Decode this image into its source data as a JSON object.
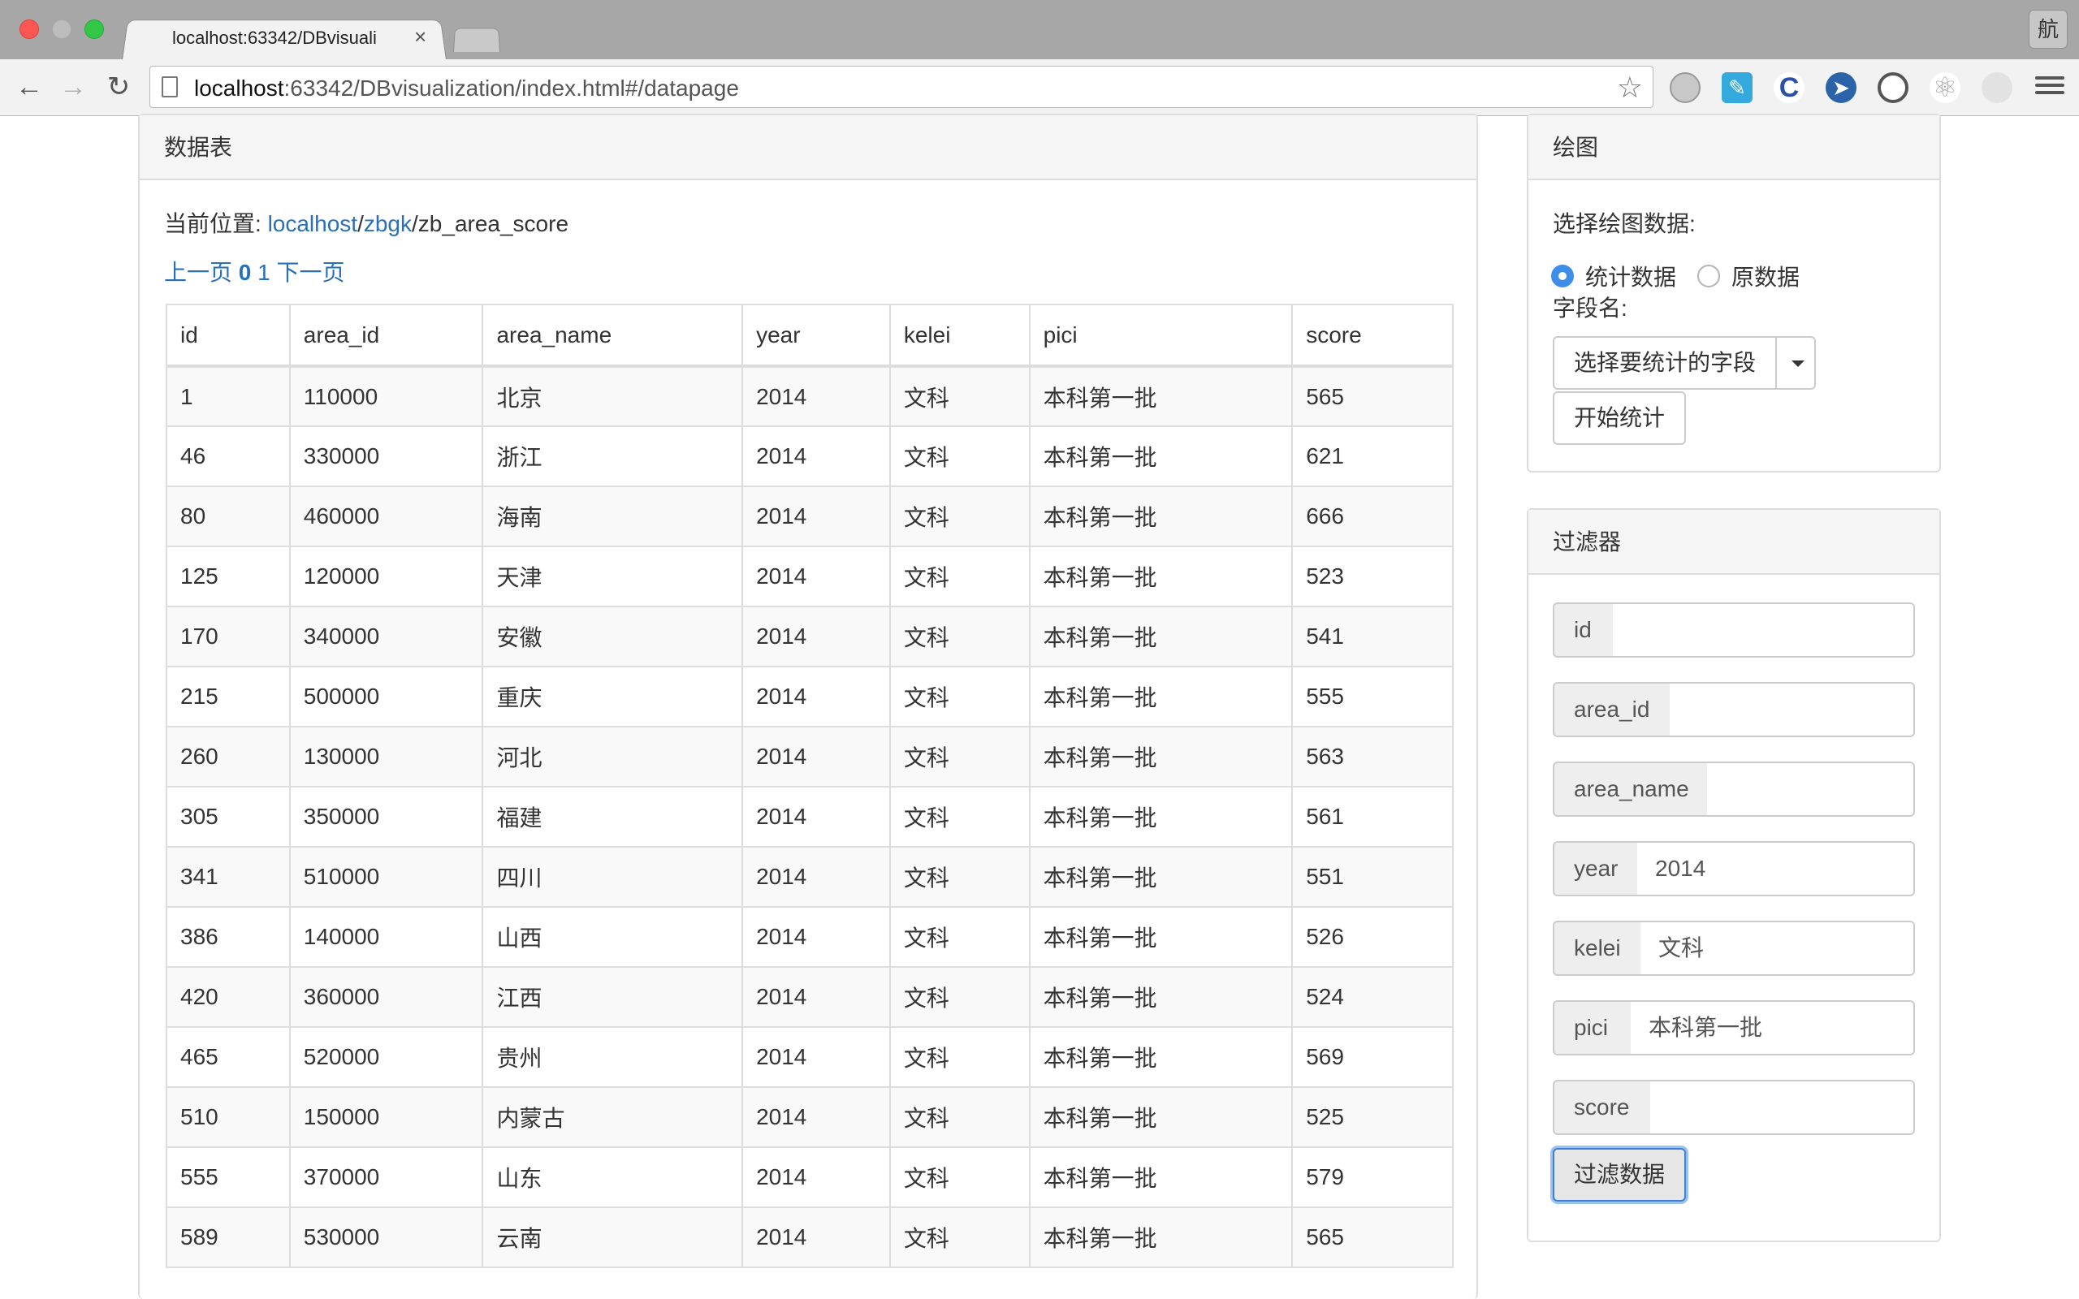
{
  "browser": {
    "tab_title": "localhost:63342/DBvisuali",
    "tab_close": "×",
    "url_host": "localhost",
    "url_path": ":63342/DBvisualization/index.html#/datapage",
    "corner_badge": "航"
  },
  "main_panel": {
    "heading": "数据表",
    "location_label": "当前位置: ",
    "crumb_host": "localhost",
    "crumb_db": "zbgk",
    "crumb_table": "zb_area_score",
    "sep": "/",
    "pager_prev": "上一页",
    "pager_page0": "0",
    "pager_page1": "1",
    "pager_next": "下一页"
  },
  "table": {
    "columns": [
      "id",
      "area_id",
      "area_name",
      "year",
      "kelei",
      "pici",
      "score"
    ],
    "rows": [
      [
        "1",
        "110000",
        "北京",
        "2014",
        "文科",
        "本科第一批",
        "565"
      ],
      [
        "46",
        "330000",
        "浙江",
        "2014",
        "文科",
        "本科第一批",
        "621"
      ],
      [
        "80",
        "460000",
        "海南",
        "2014",
        "文科",
        "本科第一批",
        "666"
      ],
      [
        "125",
        "120000",
        "天津",
        "2014",
        "文科",
        "本科第一批",
        "523"
      ],
      [
        "170",
        "340000",
        "安徽",
        "2014",
        "文科",
        "本科第一批",
        "541"
      ],
      [
        "215",
        "500000",
        "重庆",
        "2014",
        "文科",
        "本科第一批",
        "555"
      ],
      [
        "260",
        "130000",
        "河北",
        "2014",
        "文科",
        "本科第一批",
        "563"
      ],
      [
        "305",
        "350000",
        "福建",
        "2014",
        "文科",
        "本科第一批",
        "561"
      ],
      [
        "341",
        "510000",
        "四川",
        "2014",
        "文科",
        "本科第一批",
        "551"
      ],
      [
        "386",
        "140000",
        "山西",
        "2014",
        "文科",
        "本科第一批",
        "526"
      ],
      [
        "420",
        "360000",
        "江西",
        "2014",
        "文科",
        "本科第一批",
        "524"
      ],
      [
        "465",
        "520000",
        "贵州",
        "2014",
        "文科",
        "本科第一批",
        "569"
      ],
      [
        "510",
        "150000",
        "内蒙古",
        "2014",
        "文科",
        "本科第一批",
        "525"
      ],
      [
        "555",
        "370000",
        "山东",
        "2014",
        "文科",
        "本科第一批",
        "579"
      ],
      [
        "589",
        "530000",
        "云南",
        "2014",
        "文科",
        "本科第一批",
        "565"
      ]
    ]
  },
  "draw_panel": {
    "heading": "绘图",
    "select_label": "选择绘图数据:",
    "radio_stat": "统计数据",
    "radio_raw": "原数据",
    "selected": "统计数据",
    "field_label": "字段名:",
    "field_dropdown": "选择要统计的字段",
    "start_button": "开始统计"
  },
  "filter_panel": {
    "heading": "过滤器",
    "fields": [
      {
        "label": "id",
        "value": ""
      },
      {
        "label": "area_id",
        "value": ""
      },
      {
        "label": "area_name",
        "value": ""
      },
      {
        "label": "year",
        "value": "2014"
      },
      {
        "label": "kelei",
        "value": "文科"
      },
      {
        "label": "pici",
        "value": "本科第一批"
      },
      {
        "label": "score",
        "value": ""
      }
    ],
    "filter_button": "过滤数据"
  },
  "colors": {
    "link": "#2a6fba",
    "radio_selected": "#3d8ee8",
    "focus_ring": "#9cc3f0"
  }
}
